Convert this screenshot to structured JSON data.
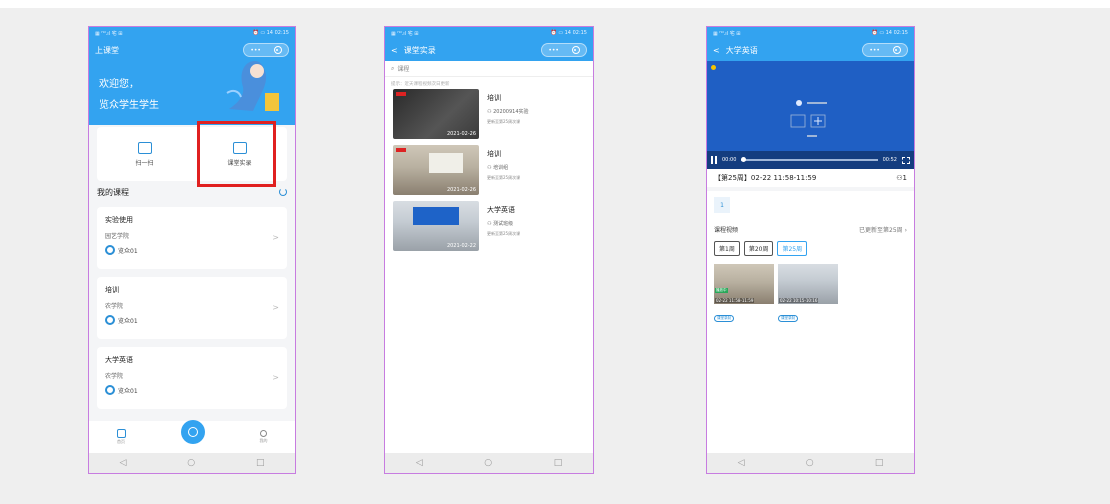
{
  "colors": {
    "primary": "#33a3f0",
    "highlight": "#e02020",
    "frame": "#c77ce0"
  },
  "status": {
    "left": "▦ ᴴᵈ.ıl 宅 ⊞",
    "right": "⏰ ▭ 14 02:15"
  },
  "capsule": {
    "dots": "•••"
  },
  "system_nav": {
    "back": "◁",
    "home": "○",
    "recent": "□"
  },
  "phone1": {
    "nav_title": "上课堂",
    "welcome": "欢迎您，",
    "user": "览众学生学生",
    "quick": [
      {
        "label": "扫一扫",
        "icon": "scan-icon"
      },
      {
        "label": "课堂实录",
        "icon": "video-record-icon"
      }
    ],
    "section_title": "我的课程",
    "courses": [
      {
        "name": "实验使用",
        "dept": "园艺学院",
        "user": "览众01"
      },
      {
        "name": "培训",
        "dept": "农学院",
        "user": "览众01"
      },
      {
        "name": "大学英语",
        "dept": "农学院",
        "user": "览众01"
      }
    ],
    "tabs": {
      "home": "首页",
      "mine": "我的"
    }
  },
  "phone2": {
    "nav_title": "课堂实录",
    "search_placeholder": "课程",
    "tip": "提示：近天课程视频次日更新",
    "records": [
      {
        "name": "培训",
        "sub": "20200914实验",
        "update": "更新至第25周次课",
        "date": "2021-02-26"
      },
      {
        "name": "培训",
        "sub": "培训组",
        "update": "更新至第25周次课",
        "date": "2021-02-26"
      },
      {
        "name": "大学英语",
        "sub": "测试班级",
        "update": "更新至第25周次课",
        "date": "2021-02-22"
      }
    ]
  },
  "phone3": {
    "nav_title": "大学英语",
    "video": {
      "current": "00:00",
      "total": "00:52"
    },
    "session": "【第25周】02-22 11:58-11:59",
    "session_count": "1",
    "page": "1",
    "video_section": "课程视频",
    "update": "已更新至第25周",
    "weeks": [
      "第1周",
      "第20周",
      "第25周"
    ],
    "videos": [
      {
        "date": "02-22 11:58-11:59",
        "tag": "课堂录制",
        "playing": "播放中"
      },
      {
        "date": "02-22 10:15-10:16",
        "tag": "课堂录制"
      }
    ]
  }
}
